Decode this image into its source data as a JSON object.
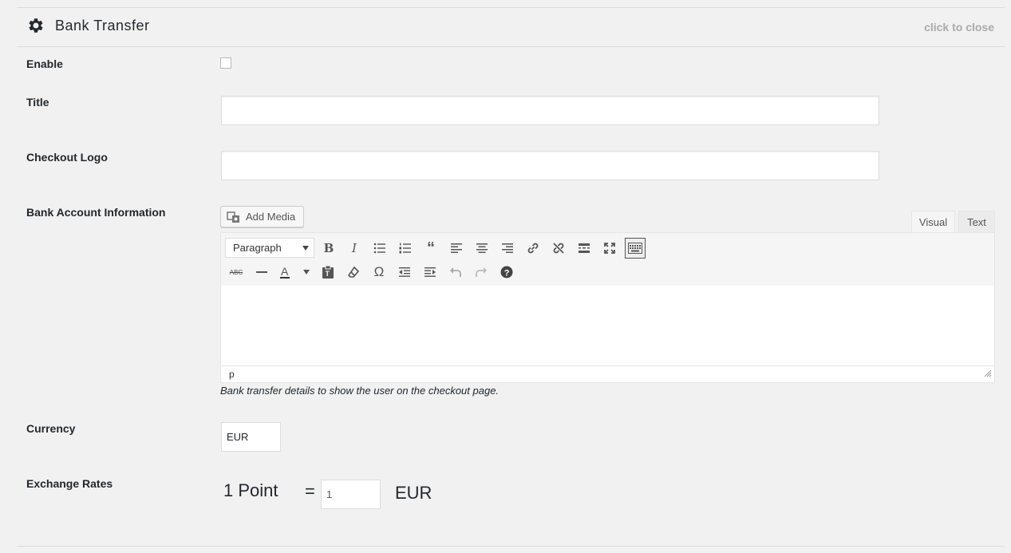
{
  "panel": {
    "title": "Bank Transfer",
    "close_label": "click to close",
    "icon": "gear-icon"
  },
  "fields": {
    "enable_label": "Enable",
    "enable_checked": false,
    "title_label": "Title",
    "title_value": "",
    "logo_label": "Checkout Logo",
    "logo_value": "",
    "bank_info_label": "Bank Account Information",
    "currency_label": "Currency",
    "currency_value": "EUR",
    "exchange_label": "Exchange Rates"
  },
  "editor": {
    "add_media_label": "Add Media",
    "tab_visual": "Visual",
    "tab_text": "Text",
    "format_select": "Paragraph",
    "path": "p",
    "help_text": "Bank transfer details to show the user on the checkout page.",
    "toolbar_row1": [
      "bold-icon",
      "italic-icon",
      "bullet-list-icon",
      "numbered-list-icon",
      "blockquote-icon",
      "align-left-icon",
      "align-center-icon",
      "align-right-icon",
      "link-icon",
      "unlink-icon",
      "read-more-icon",
      "fullscreen-icon",
      "toolbar-toggle-icon"
    ],
    "toolbar_row2": [
      "strikethrough-icon",
      "horizontal-line-icon",
      "text-color-icon",
      "paste-text-icon",
      "clear-formatting-icon",
      "special-character-icon",
      "outdent-icon",
      "indent-icon",
      "undo-icon",
      "redo-icon",
      "help-icon"
    ]
  },
  "exchange": {
    "point_text": "1 Point",
    "equals": "=",
    "rate_value": "1",
    "currency": "EUR"
  }
}
